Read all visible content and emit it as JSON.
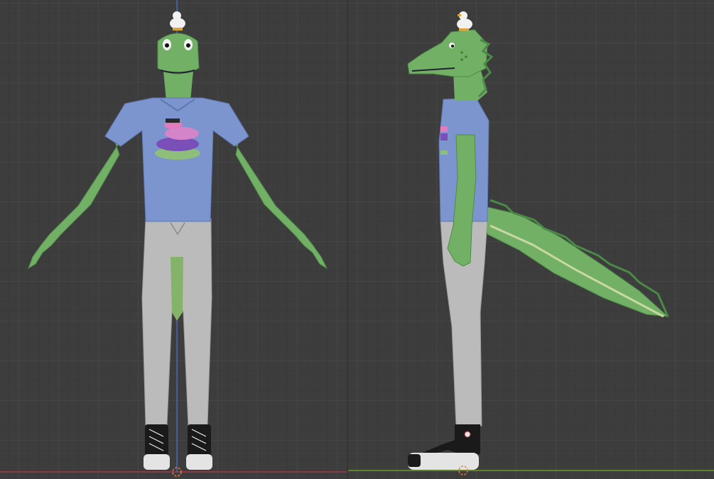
{
  "viewports": [
    {
      "name": "front-orthographic"
    },
    {
      "name": "right-orthographic"
    }
  ],
  "colors": {
    "background": "#3d3d3d",
    "grid_major": "#464646",
    "grid_minor": "#3a3a3a",
    "axis_x": "#a33a45",
    "axis_y": "#6a9a2a",
    "axis_z": "#4a6ed6",
    "skin": "#72b066",
    "skin_shadow": "#4f8a48",
    "belly": "#c9d7a2",
    "shirt": "#7c95cf",
    "pants": "#bbbbbb",
    "shoe": "#1a1a1a",
    "shoe_sole": "#e4e4e4",
    "origin_marker": "#e87a40"
  },
  "objects": [
    {
      "name": "dino-character",
      "shirt_print": "stacked-critters-graphic"
    },
    {
      "name": "duck-figurine"
    }
  ]
}
